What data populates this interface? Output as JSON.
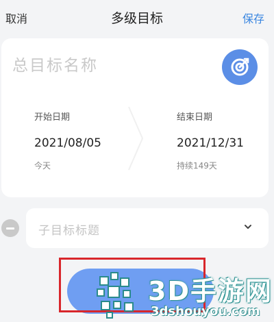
{
  "header": {
    "cancel_label": "取消",
    "title": "多级目标",
    "save_label": "保存"
  },
  "goal_card": {
    "name_placeholder": "总目标名称",
    "start": {
      "label": "开始日期",
      "date": "2021/08/05",
      "note": "今天"
    },
    "end": {
      "label": "结束日期",
      "date": "2021/12/31",
      "note": "持续149天"
    }
  },
  "subgoal": {
    "placeholder": "子目标标题"
  },
  "watermark": {
    "brand": "3D手游网",
    "domain": "3dshouyou.com"
  },
  "colors": {
    "accent": "#3a86e0",
    "target_button": "#5b8ee6",
    "add_button": "#6f9ef2",
    "highlight_box": "#d8262b"
  }
}
